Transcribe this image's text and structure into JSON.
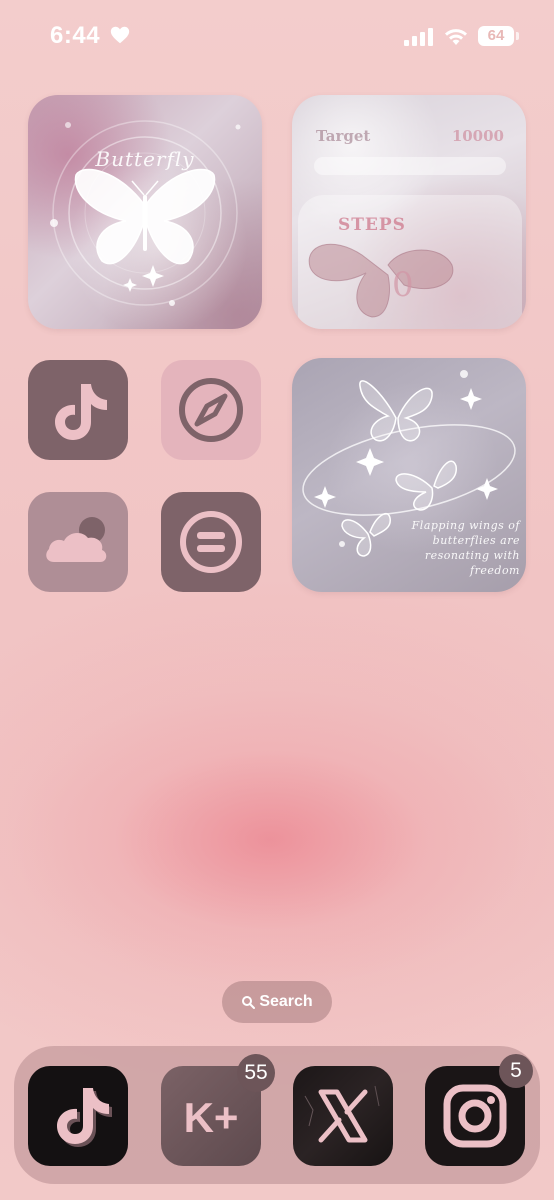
{
  "status_bar": {
    "time": "6:44",
    "battery": "64",
    "icons": [
      "heart-icon",
      "signal-bars-icon",
      "wifi-icon",
      "battery-icon"
    ]
  },
  "widgets": {
    "butterfly": {
      "title": "Butterfly"
    },
    "steps": {
      "target_label": "Target",
      "target_value": "10000",
      "label": "STEPS",
      "count": "0"
    },
    "quote": {
      "text": "Flapping wings of butterflies are resonating with freedom"
    }
  },
  "apps": [
    {
      "icon": "tiktok-icon"
    },
    {
      "icon": "compass-icon"
    },
    {
      "icon": "cloud-icon"
    },
    {
      "icon": "equals-icon"
    }
  ],
  "search": {
    "label": "Search",
    "icon": "search-icon"
  },
  "dock": {
    "apps": [
      {
        "icon": "tiktok-icon"
      },
      {
        "icon": "kplus-icon",
        "text": "K+",
        "badge": "55"
      },
      {
        "icon": "x-logo-icon"
      },
      {
        "icon": "instagram-icon",
        "badge": "5"
      }
    ]
  },
  "colors": {
    "wallpaper_pink": "#f2c9c8",
    "wallpaper_blush": "#ec8c96",
    "icon_dark_mauve": "#7e6369",
    "icon_light_pink": "#e4b4bc",
    "icon_mid_mauve": "#af8e96",
    "glyph_pink": "#ecc0c6"
  }
}
